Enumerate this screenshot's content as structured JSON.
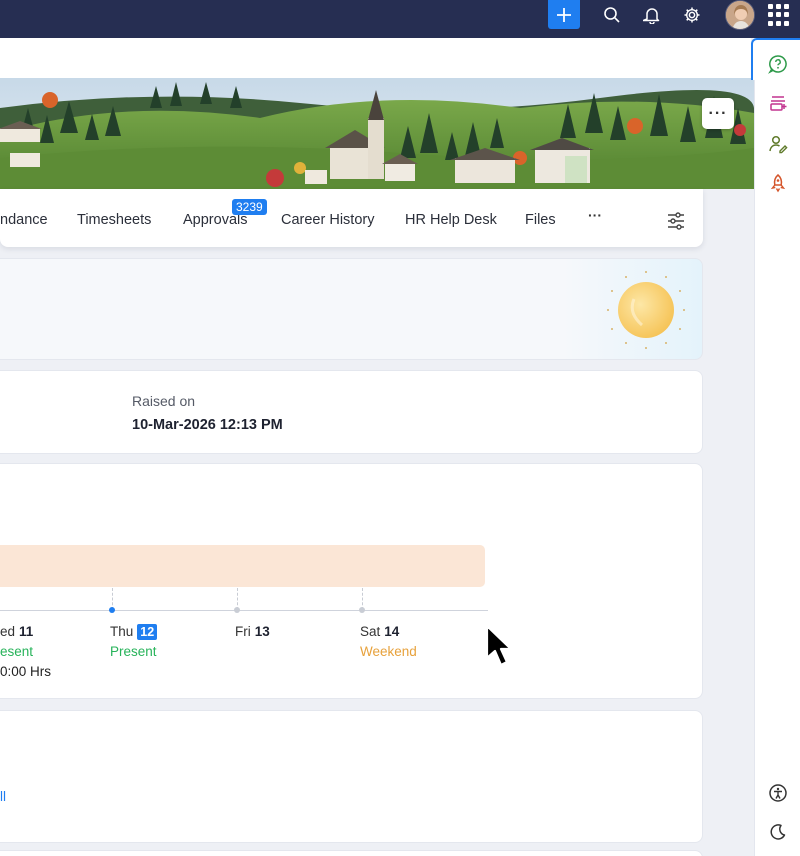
{
  "topbar": {
    "icons": [
      "plus-icon",
      "search-icon",
      "bell-icon",
      "gear-icon",
      "avatar",
      "apps-grid-icon"
    ]
  },
  "rail": {
    "icons": [
      "help-icon",
      "queue-add-icon",
      "user-edit-icon",
      "rocket-icon",
      "accessibility-icon",
      "dark-mode-icon"
    ]
  },
  "banner": {
    "more_label": "···"
  },
  "tabs": {
    "items": [
      {
        "label": "ndance"
      },
      {
        "label": "Timesheets"
      },
      {
        "label": "Approvals"
      },
      {
        "label": "Career History"
      },
      {
        "label": "HR Help Desk"
      },
      {
        "label": "Files"
      }
    ],
    "approvals_badge": "3239",
    "more_label": "···"
  },
  "request": {
    "raised_label": "Raised on",
    "raised_value": "10-Mar-2026 12:13 PM"
  },
  "week": {
    "days": [
      {
        "name": "ed",
        "date": "11",
        "status": "esent",
        "hours": "0:00 Hrs"
      },
      {
        "name": "Thu",
        "date": "12",
        "status": "Present",
        "today": true
      },
      {
        "name": "Fri",
        "date": "13",
        "status": ""
      },
      {
        "name": "Sat",
        "date": "14",
        "status": "Weekend"
      }
    ],
    "colors": {
      "present": "#27b35a",
      "weekend": "#e7a13b",
      "today": "#1f7ef0",
      "shift": "#fbe6d6"
    }
  },
  "bottom": {
    "link_text": "ll"
  }
}
